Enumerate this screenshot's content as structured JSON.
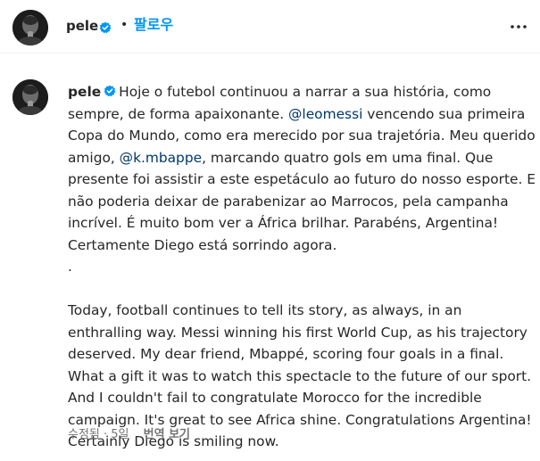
{
  "header": {
    "username": "pele",
    "separator": "•",
    "follow_label": "팔로우"
  },
  "caption": {
    "username": "pele",
    "pt": {
      "text_1": "Hoje o futebol continuou a narrar a sua história, como sempre, de forma apaixonante. ",
      "mention_1": "@leomessi",
      "text_2": " vencendo sua primeira Copa do Mundo, como era merecido por sua trajetória. Meu querido amigo, ",
      "mention_2": "@k.mbappe",
      "text_3": ", marcando quatro gols em uma final. Que presente foi assistir a este espetáculo ao futuro do nosso esporte. E não poderia deixar de parabenizar ao Marrocos, pela campanha incrível. É muito bom ver a África brilhar. Parabéns, Argentina! Certamente Diego está sorrindo agora."
    },
    "separator_line": ".",
    "en_text": "Today, football continues to tell its story, as always, in an enthralling way. Messi winning his first World Cup, as his trajectory deserved. My dear friend, Mbappé, scoring four goals in a final. What a gift it was to watch this spectacle to the future of our sport. And I couldn't fail to congratulate Morocco for the incredible campaign. It's great to see Africa shine. Congratulations Argentina! Certainly Diego is smiling now."
  },
  "meta": {
    "edited_time": "수정됨 · 5일",
    "see_translation": "번역 보기"
  },
  "colors": {
    "link": "#0095f6",
    "mention": "#00376b",
    "verified": "#0095f6",
    "secondary_text": "#737373"
  }
}
